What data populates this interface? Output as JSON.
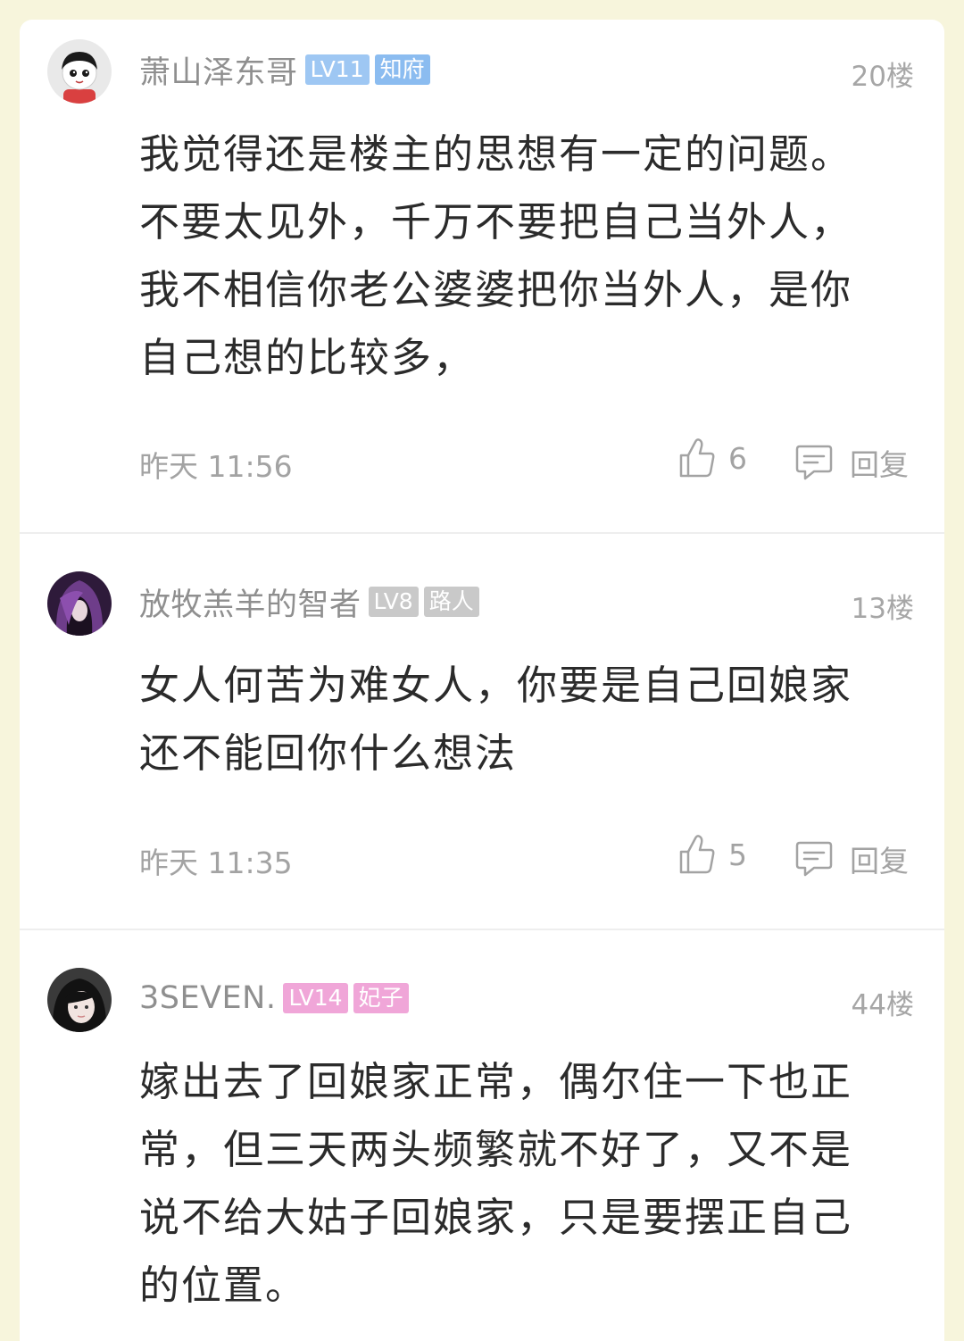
{
  "colors": {
    "page_background": "#f7f5dc",
    "card_background": "#ffffff",
    "badge_lv_blue": "#9ec7f3",
    "badge_title_blue": "#8bbcf0",
    "badge_gray": "#c9c9c9",
    "badge_pink": "#f0a6d8",
    "meta_gray": "#a3a3a3"
  },
  "comments": [
    {
      "username": "萧山泽东哥",
      "level": "LV11",
      "title": "知府",
      "badge_style": "blue",
      "floor": "20楼",
      "avatar_icon": "cartoon-boy-avatar",
      "text_lines": [
        "我觉得还是楼主的思想有一定的问题。",
        "不要太见外，千万不要把自己当外人，",
        "我不相信你老公婆婆把你当外人，是你",
        "自己想的比较多，"
      ],
      "time": "昨天 11:56",
      "likes": "6",
      "reply_label": "回复"
    },
    {
      "username": "放牧羔羊的智者",
      "level": "LV8",
      "title": "路人",
      "badge_style": "gray",
      "floor": "13楼",
      "avatar_icon": "purple-hair-avatar",
      "text_lines": [
        "女人何苦为难女人，你要是自己回娘家",
        "还不能回你什么想法"
      ],
      "time": "昨天 11:35",
      "likes": "5",
      "reply_label": "回复"
    },
    {
      "username": "3SEVEN.",
      "level": "LV14",
      "title": "妃子",
      "badge_style": "pink",
      "floor": "44楼",
      "avatar_icon": "girl-photo-avatar",
      "text_lines": [
        "嫁出去了回娘家正常，偶尔住一下也正",
        "常，但三天两头频繁就不好了，又不是",
        "说不给大姑子回娘家，只是要摆正自己",
        "的位置。"
      ]
    }
  ]
}
